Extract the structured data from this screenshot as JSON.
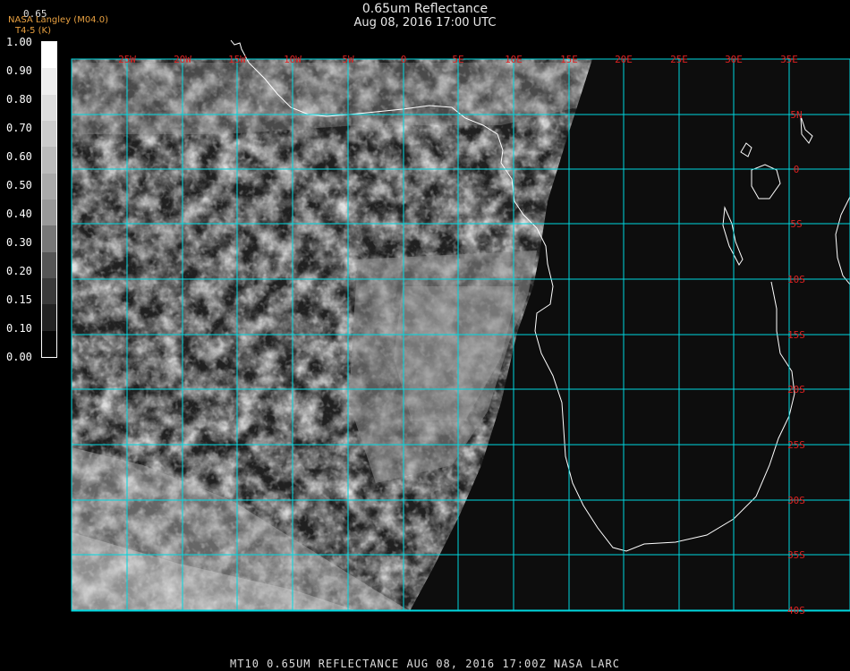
{
  "header": {
    "title": "0.65um Reflectance",
    "subtitle": "Aug 08, 2016 17:00 UTC",
    "org_line1": "NASA Langley (M04.0)",
    "org_line2": "T4-5 (K)",
    "cbar_top": "0.65"
  },
  "colorbar": {
    "labels": [
      "1.00",
      "0.90",
      "0.80",
      "0.70",
      "0.60",
      "0.50",
      "0.40",
      "0.30",
      "0.20",
      "0.15",
      "0.10",
      "0.00"
    ],
    "colors": [
      "#ffffff",
      "#eeeeee",
      "#dddddd",
      "#cccccc",
      "#bbbbbb",
      "#aaaaaa",
      "#999999",
      "#777777",
      "#555555",
      "#3a3a3a",
      "#222222",
      "#050505"
    ]
  },
  "map": {
    "lon_labels": [
      "25W",
      "20W",
      "15W",
      "10W",
      "5W",
      "0",
      "5E",
      "10E",
      "15E",
      "20E",
      "25E",
      "30E",
      "35E"
    ],
    "lat_labels": [
      "5N",
      "0",
      "5S",
      "10S",
      "15S",
      "20S",
      "25S",
      "30S",
      "35S",
      "40S"
    ],
    "grid_color": "#00d8e0",
    "label_color": "#e02020",
    "coast_color": "#ffffff"
  },
  "footer": {
    "text": "MT10  0.65UM REFLECTANCE   AUG 08, 2016 17:00Z   NASA LARC"
  }
}
